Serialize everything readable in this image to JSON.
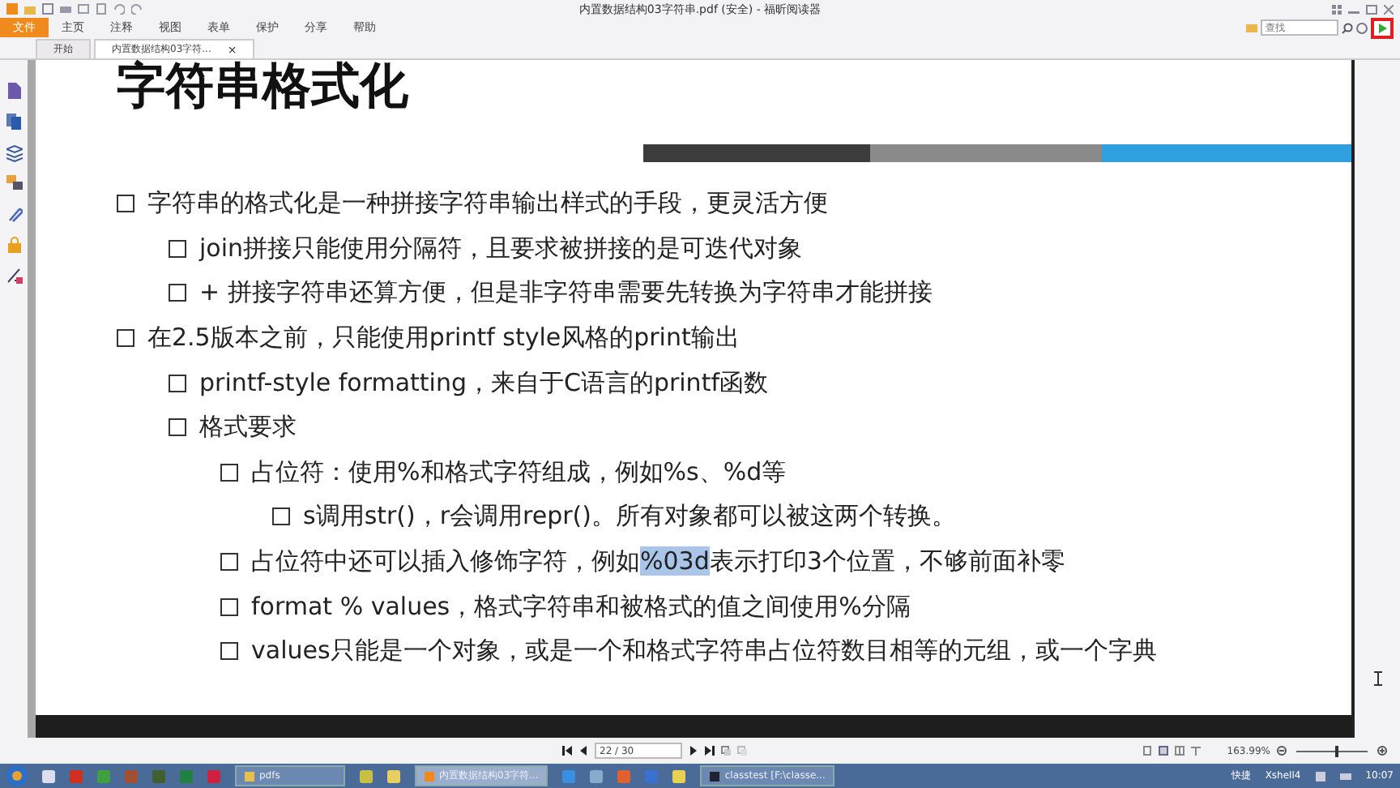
{
  "window": {
    "title": "内置数据结构03字符串.pdf (安全) - 福昕阅读器"
  },
  "menu": [
    {
      "label": "文件",
      "selected": true
    },
    {
      "label": "主页",
      "selected": false
    },
    {
      "label": "注释",
      "selected": false
    },
    {
      "label": "视图",
      "selected": false
    },
    {
      "label": "表单",
      "selected": false
    },
    {
      "label": "保护",
      "selected": false
    },
    {
      "label": "分享",
      "selected": false
    },
    {
      "label": "帮助",
      "selected": false
    }
  ],
  "search": {
    "placeholder": "查找"
  },
  "tabs": [
    {
      "label": "开始",
      "selected": false
    },
    {
      "label": "内置数据结构03字符...",
      "selected": true,
      "close": "×"
    }
  ],
  "slide": {
    "title": "字符串格式化",
    "bullets": [
      {
        "text": "字符串的格式化是一种拼接字符串输出样式的手段，更灵活方便",
        "children": [
          {
            "text": "join拼接只能使用分隔符，且要求被拼接的是可迭代对象"
          },
          {
            "text": "+ 拼接字符串还算方便，但是非字符串需要先转换为字符串才能拼接"
          }
        ]
      },
      {
        "text": "在2.5版本之前，只能使用printf style风格的print输出",
        "children": [
          {
            "text": "printf-style formatting，来自于C语言的printf函数"
          },
          {
            "text": "格式要求",
            "children": [
              {
                "text": "占位符：使用%和格式字符组成，例如%s、%d等",
                "children": [
                  {
                    "text": "s调用str()，r会调用repr()。所有对象都可以被这两个转换。"
                  }
                ]
              },
              {
                "runs": [
                  {
                    "text": "占位符中还可以插入修饰字符，例如",
                    "highlighted": false
                  },
                  {
                    "text": "%03d",
                    "highlighted": true
                  },
                  {
                    "text": "表示打印3个位置，不够前面补零",
                    "highlighted": false
                  }
                ]
              },
              {
                "text": "format % values，格式字符串和被格式的值之间使用%分隔"
              },
              {
                "text": "values只能是一个对象，或是一个和格式字符串占位符数目相等的元组，或一个字典"
              }
            ]
          }
        ]
      }
    ]
  },
  "status_bar": {
    "page": "22 / 30",
    "zoom": "163.99%",
    "level": 0.57
  },
  "taskbar": {
    "items": [
      {
        "label": "pdfs",
        "selected": false
      },
      {
        "label": "内置数据结构03字符...",
        "selected": true
      },
      {
        "label": "classtest [F:\\classe...",
        "selected": false
      }
    ],
    "tray": [
      {
        "label": "快捷"
      },
      {
        "label": "Xshell4"
      }
    ],
    "clock": "10:07"
  }
}
